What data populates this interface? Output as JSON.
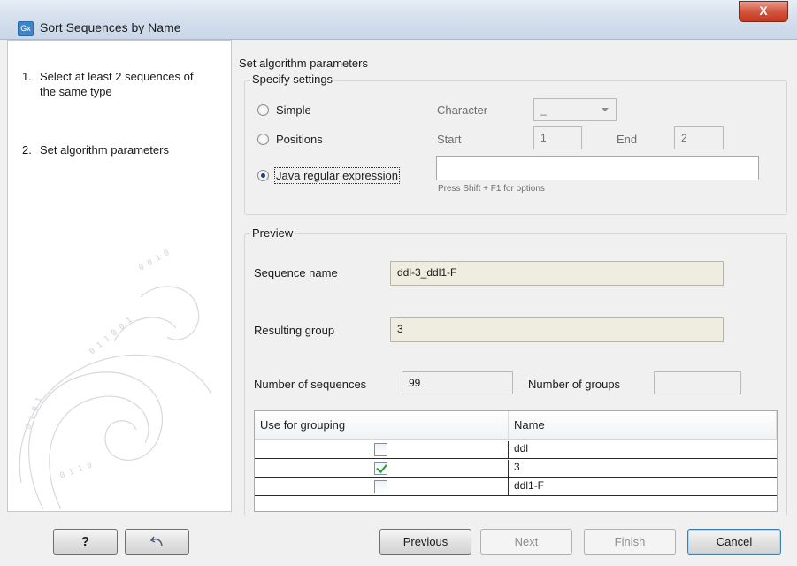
{
  "window": {
    "title": "Sort Sequences by Name",
    "app_icon": "Gx",
    "close_label": "X"
  },
  "steps": [
    {
      "num": "1.",
      "label": "Select at least 2 sequences of the same type"
    },
    {
      "num": "2.",
      "label": "Set algorithm parameters"
    }
  ],
  "main": {
    "heading": "Set algorithm parameters",
    "settings": {
      "title": "Specify settings",
      "options": [
        {
          "label": "Simple",
          "selected": false
        },
        {
          "label": "Positions",
          "selected": false
        },
        {
          "label": "Java regular expression",
          "selected": true
        }
      ],
      "character_label": "Character",
      "character_value": "_",
      "start_label": "Start",
      "start_value": "1",
      "end_label": "End",
      "end_value": "2",
      "regex_value": "",
      "regex_hint": "Press Shift + F1 for options"
    },
    "preview": {
      "title": "Preview",
      "sequence_name_label": "Sequence name",
      "sequence_name_value": "ddl-3_ddl1-F",
      "resulting_group_label": "Resulting group",
      "resulting_group_value": "3",
      "num_sequences_label": "Number of sequences",
      "num_sequences_value": "99",
      "num_groups_label": "Number of groups",
      "num_groups_value": "",
      "table": {
        "headers": [
          "Use for grouping",
          "Name"
        ],
        "rows": [
          {
            "checked": false,
            "name": "ddl"
          },
          {
            "checked": true,
            "name": "3"
          },
          {
            "checked": false,
            "name": "ddl1-F"
          }
        ]
      }
    }
  },
  "footer": {
    "help_label": "?",
    "reset_icon": "undo-arrow-icon",
    "previous_label": "Previous",
    "next_label": "Next",
    "finish_label": "Finish",
    "cancel_label": "Cancel"
  }
}
